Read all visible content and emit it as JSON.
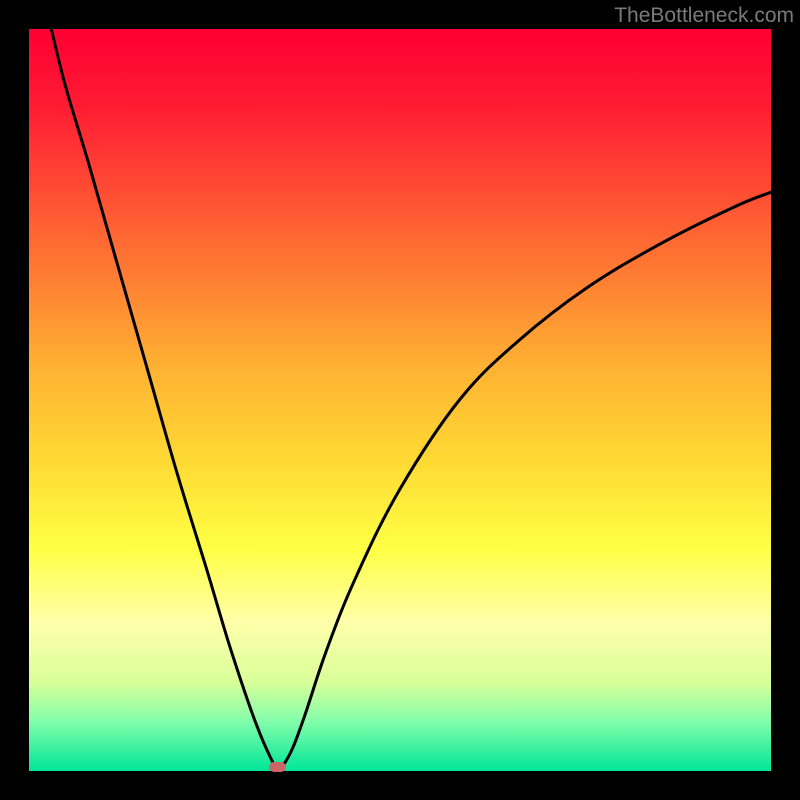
{
  "watermark": "TheBottleneck.com",
  "chart_data": {
    "type": "line",
    "title": "",
    "xlabel": "",
    "ylabel": "",
    "xlim": [
      0,
      100
    ],
    "ylim": [
      0,
      100
    ],
    "legend": false,
    "grid": false,
    "background": "rainbow-vertical-gradient-red-to-green",
    "series": [
      {
        "name": "bottleneck-curve",
        "color": "#000000",
        "points": [
          {
            "x": 3.0,
            "y": 100.0
          },
          {
            "x": 5.0,
            "y": 92.0
          },
          {
            "x": 8.0,
            "y": 82.0
          },
          {
            "x": 12.0,
            "y": 68.0
          },
          {
            "x": 16.0,
            "y": 54.0
          },
          {
            "x": 20.0,
            "y": 40.0
          },
          {
            "x": 24.0,
            "y": 27.0
          },
          {
            "x": 27.0,
            "y": 17.0
          },
          {
            "x": 30.0,
            "y": 8.0
          },
          {
            "x": 32.0,
            "y": 3.0
          },
          {
            "x": 33.5,
            "y": 0.5
          },
          {
            "x": 35.0,
            "y": 2.0
          },
          {
            "x": 37.0,
            "y": 7.0
          },
          {
            "x": 40.0,
            "y": 16.0
          },
          {
            "x": 44.0,
            "y": 26.0
          },
          {
            "x": 50.0,
            "y": 38.0
          },
          {
            "x": 58.0,
            "y": 50.0
          },
          {
            "x": 66.0,
            "y": 58.0
          },
          {
            "x": 75.0,
            "y": 65.0
          },
          {
            "x": 85.0,
            "y": 71.0
          },
          {
            "x": 95.0,
            "y": 76.0
          },
          {
            "x": 100.0,
            "y": 78.0
          }
        ]
      }
    ],
    "marker": {
      "name": "optimum-point",
      "x": 33.5,
      "y": 0.5,
      "color": "#cc6666",
      "shape": "rounded-rect",
      "width_pct": 2.2,
      "height_pct": 1.4
    }
  }
}
